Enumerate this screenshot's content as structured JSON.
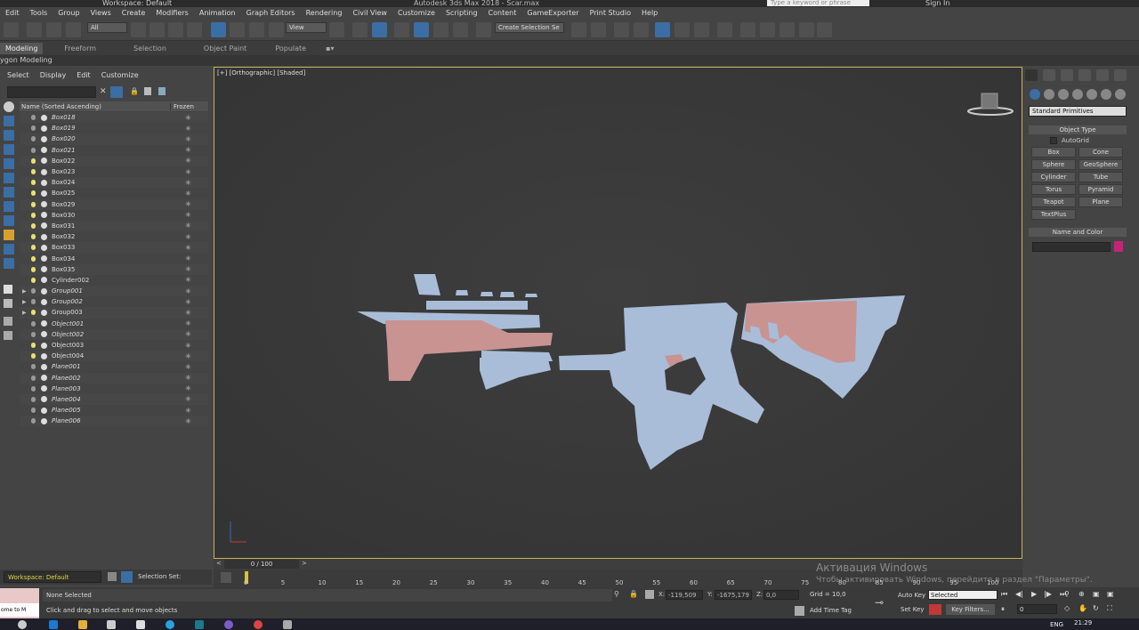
{
  "titlebar": {
    "workspace": "Workspace: Default",
    "app_title": "Autodesk 3ds Max 2018 - Scar.max",
    "search_placeholder": "Type a keyword or phrase",
    "signin": "Sign In"
  },
  "menu": [
    "Edit",
    "Tools",
    "Group",
    "Views",
    "Create",
    "Modifiers",
    "Animation",
    "Graph Editors",
    "Rendering",
    "Civil View",
    "Customize",
    "Scripting",
    "Content",
    "GameExporter",
    "Print Studio",
    "Help"
  ],
  "toolbar": {
    "filter_value": "All",
    "view_value": "View",
    "selection_set_placeholder": "Create Selection Se"
  },
  "ribbon": {
    "tabs": [
      "Modeling",
      "Freeform",
      "Selection",
      "Object Paint",
      "Populate"
    ],
    "active": "Modeling",
    "subtitle": "ygon Modeling"
  },
  "scene_explorer": {
    "menu": [
      "Select",
      "Display",
      "Edit",
      "Customize"
    ],
    "columns": [
      "Name (Sorted Ascending)",
      "Frozen"
    ],
    "items": [
      {
        "name": "Box018",
        "italic": true,
        "light": false,
        "arrow": false
      },
      {
        "name": "Box019",
        "italic": true,
        "light": false,
        "arrow": false
      },
      {
        "name": "Box020",
        "italic": true,
        "light": false,
        "arrow": false
      },
      {
        "name": "Box021",
        "italic": true,
        "light": false,
        "arrow": false
      },
      {
        "name": "Box022",
        "italic": false,
        "light": true,
        "arrow": false
      },
      {
        "name": "Box023",
        "italic": false,
        "light": true,
        "arrow": false
      },
      {
        "name": "Box024",
        "italic": false,
        "light": true,
        "arrow": false
      },
      {
        "name": "Box025",
        "italic": false,
        "light": true,
        "arrow": false
      },
      {
        "name": "Box029",
        "italic": false,
        "light": true,
        "arrow": false
      },
      {
        "name": "Box030",
        "italic": false,
        "light": true,
        "arrow": false
      },
      {
        "name": "Box031",
        "italic": false,
        "light": true,
        "arrow": false
      },
      {
        "name": "Box032",
        "italic": false,
        "light": true,
        "arrow": false
      },
      {
        "name": "Box033",
        "italic": false,
        "light": true,
        "arrow": false
      },
      {
        "name": "Box034",
        "italic": false,
        "light": true,
        "arrow": false
      },
      {
        "name": "Box035",
        "italic": false,
        "light": true,
        "arrow": false
      },
      {
        "name": "Cylinder002",
        "italic": false,
        "light": true,
        "arrow": false
      },
      {
        "name": "Group001",
        "italic": true,
        "light": false,
        "arrow": true
      },
      {
        "name": "Group002",
        "italic": true,
        "light": false,
        "arrow": true
      },
      {
        "name": "Group003",
        "italic": false,
        "light": true,
        "arrow": true
      },
      {
        "name": "Object001",
        "italic": true,
        "light": false,
        "arrow": false
      },
      {
        "name": "Object002",
        "italic": true,
        "light": false,
        "arrow": false
      },
      {
        "name": "Object003",
        "italic": false,
        "light": true,
        "arrow": false
      },
      {
        "name": "Object004",
        "italic": false,
        "light": true,
        "arrow": false
      },
      {
        "name": "Plane001",
        "italic": true,
        "light": false,
        "arrow": false
      },
      {
        "name": "Plane002",
        "italic": true,
        "light": false,
        "arrow": false
      },
      {
        "name": "Plane003",
        "italic": true,
        "light": false,
        "arrow": false
      },
      {
        "name": "Plane004",
        "italic": true,
        "light": false,
        "arrow": false
      },
      {
        "name": "Plane005",
        "italic": true,
        "light": false,
        "arrow": false
      },
      {
        "name": "Plane006",
        "italic": true,
        "light": false,
        "arrow": false
      }
    ],
    "frozen_glyph": "✳",
    "workspace_label": "Workspace: Default",
    "selection_set_label": "Selection Set:"
  },
  "viewport": {
    "label": "[+] [Orthographic] [Shaded]"
  },
  "command_panel": {
    "category": "Standard Primitives",
    "object_type_title": "Object Type",
    "autogrid": "AutoGrid",
    "buttons": [
      "Box",
      "Cone",
      "Sphere",
      "GeoSphere",
      "Cylinder",
      "Tube",
      "Torus",
      "Pyramid",
      "Teapot",
      "Plane",
      "TextPlus"
    ],
    "name_color_title": "Name and Color",
    "object_color": "#c8227a"
  },
  "timeline": {
    "frame_counter": "0 / 100",
    "ticks": [
      "0",
      "5",
      "10",
      "15",
      "20",
      "25",
      "30",
      "35",
      "40",
      "45",
      "50",
      "55",
      "60",
      "65",
      "70",
      "75",
      "80",
      "85",
      "90",
      "95",
      "100"
    ]
  },
  "status": {
    "listener_text": "ome to M",
    "selection": "None Selected",
    "prompt": "Click and drag to select and move objects",
    "x_label": "X:",
    "x_value": "-119,509",
    "y_label": "Y:",
    "y_value": "-1675,179",
    "z_label": "Z:",
    "z_value": "0,0",
    "grid": "Grid = 10,0",
    "add_time_tag": "Add Time Tag",
    "auto_key": "Auto Key",
    "set_key": "Set Key",
    "selected_dd": "Selected",
    "key_filters": "Key Filters...",
    "frame_value": "0"
  },
  "watermark": {
    "line1": "Активация Windows",
    "line2": "Чтобы активировать Windows, перейдите в раздел \"Параметры\"."
  },
  "taskbar": {
    "lang": "ENG",
    "time": "21:29"
  }
}
